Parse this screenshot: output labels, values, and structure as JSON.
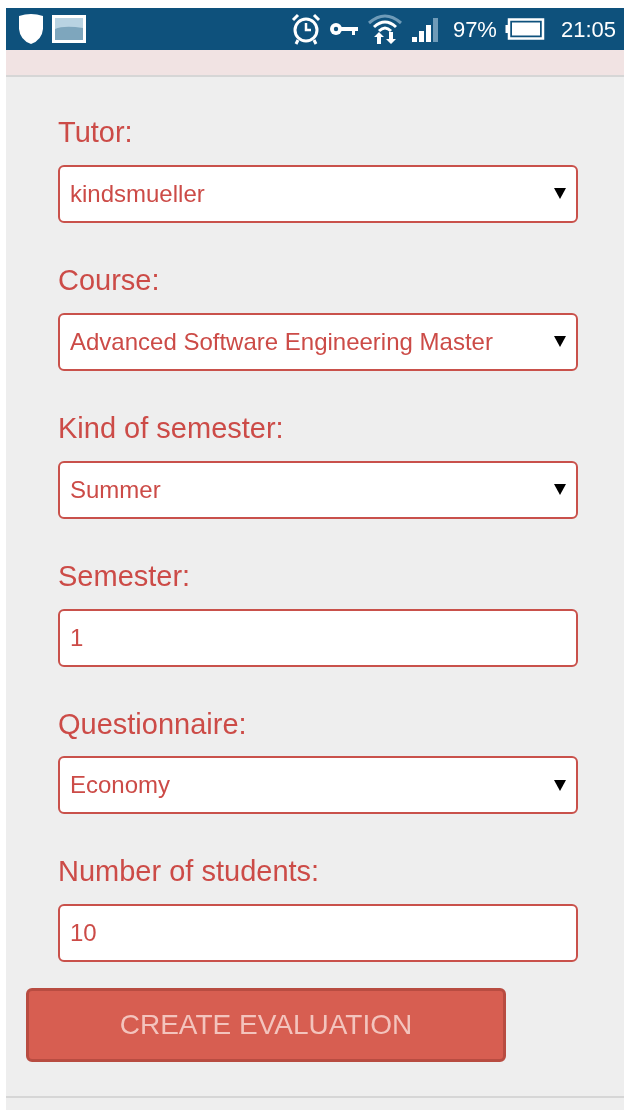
{
  "status_bar": {
    "battery": "97%",
    "time": "21:05"
  },
  "fields": [
    {
      "label": "Tutor:",
      "kind": "select",
      "value": "kindsmueller"
    },
    {
      "label": "Course:",
      "kind": "select",
      "value": "Advanced Software Engineering Master"
    },
    {
      "label": "Kind of semester:",
      "kind": "select",
      "value": "Summer"
    },
    {
      "label": "Semester:",
      "kind": "input",
      "value": "1"
    },
    {
      "label": "Questionnaire:",
      "kind": "select",
      "value": "Economy"
    },
    {
      "label": "Number of students:",
      "kind": "input",
      "value": "10"
    }
  ],
  "submit_button": {
    "label": "CREATE EVALUATION"
  }
}
